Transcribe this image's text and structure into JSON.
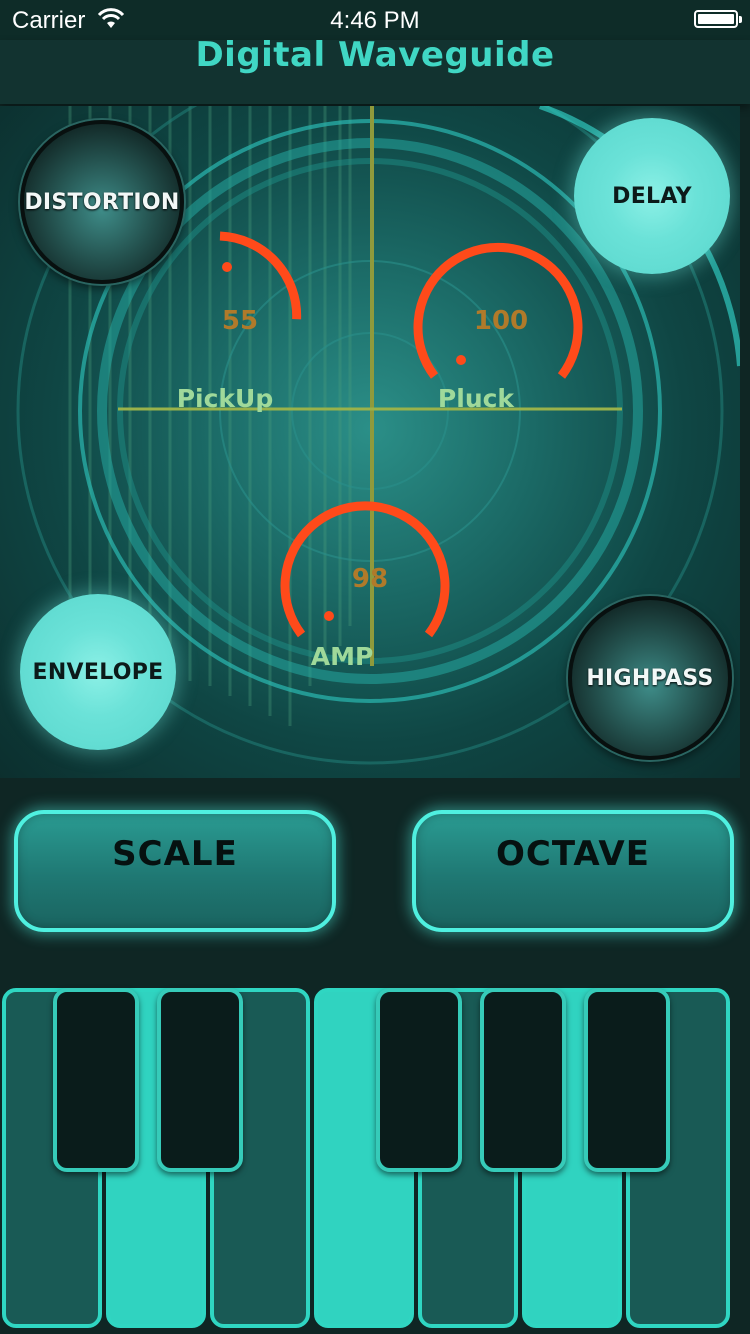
{
  "status_bar": {
    "carrier": "Carrier",
    "time": "4:46 PM"
  },
  "header": {
    "title": "Digital Waveguide"
  },
  "effects": {
    "distortion": "DISTORTION",
    "delay": "DELAY",
    "envelope": "ENVELOPE",
    "highpass": "HIGHPASS"
  },
  "knobs": {
    "pickup": {
      "label": "PickUp",
      "value": "55"
    },
    "pluck": {
      "label": "Pluck",
      "value": "100"
    },
    "amp": {
      "label": "AMP",
      "value": "98"
    }
  },
  "buttons": {
    "scale": "SCALE",
    "octave": "OCTAVE"
  },
  "colors": {
    "accent": "#40d7c4",
    "knob_arc": "#ff4a1a",
    "knob_value": "#b07a2a",
    "knob_label": "#9fd99a"
  }
}
